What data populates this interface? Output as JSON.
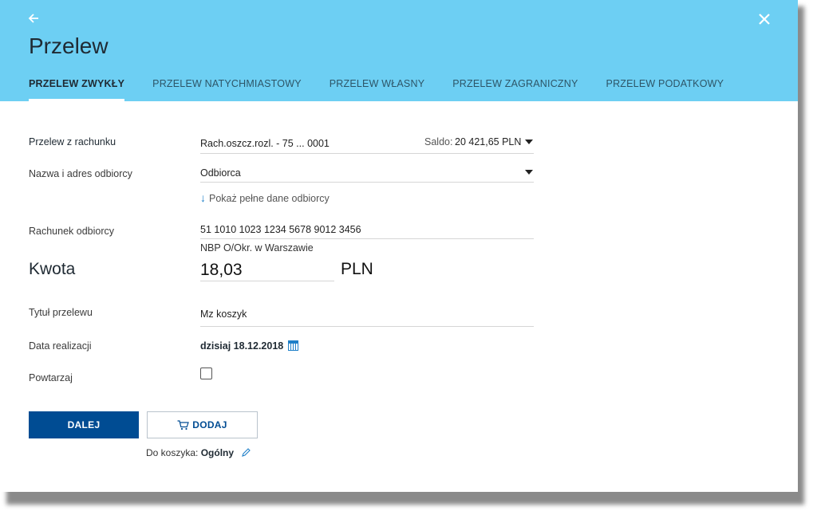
{
  "header": {
    "title": "Przelew",
    "back_icon": "arrow-left-icon",
    "close_icon": "close-icon",
    "tabs": [
      {
        "label": "PRZELEW ZWYKŁY",
        "active": true
      },
      {
        "label": "PRZELEW NATYCHMIASTOWY",
        "active": false
      },
      {
        "label": "PRZELEW WŁASNY",
        "active": false
      },
      {
        "label": "PRZELEW ZAGRANICZNY",
        "active": false
      },
      {
        "label": "PRZELEW PODATKOWY",
        "active": false
      }
    ]
  },
  "form": {
    "from_account": {
      "label": "Przelew z rachunku",
      "value": "Rach.oszcz.rozl. - 75 ... 0001",
      "saldo_label": "Saldo:",
      "saldo_value": "20 421,65 PLN"
    },
    "recipient": {
      "label": "Nazwa i adres odbiorcy",
      "value": "Odbiorca",
      "show_details_link": "Pokaż pełne dane odbiorcy"
    },
    "recipient_account": {
      "label": "Rachunek odbiorcy",
      "value": "51 1010 1023 1234 5678 9012 3456",
      "bank_name": "NBP O/Okr. w Warszawie"
    },
    "amount": {
      "label": "Kwota",
      "value": "18,03",
      "currency": "PLN"
    },
    "title": {
      "label": "Tytuł przelewu",
      "value": "Mz koszyk"
    },
    "date": {
      "label": "Data realizacji",
      "value": "dzisiaj 18.12.2018",
      "icon": "calendar-icon"
    },
    "repeat": {
      "label": "Powtarzaj",
      "checked": false
    }
  },
  "actions": {
    "next_label": "DALEJ",
    "add_label": "DODAJ",
    "add_icon": "cart-icon",
    "basket_label": "Do koszyka:",
    "basket_value": "Ogólny",
    "edit_icon": "pencil-icon"
  },
  "colors": {
    "header_bg": "#6dcff3",
    "primary": "#004c93",
    "link_accent": "#1e7fc8"
  }
}
